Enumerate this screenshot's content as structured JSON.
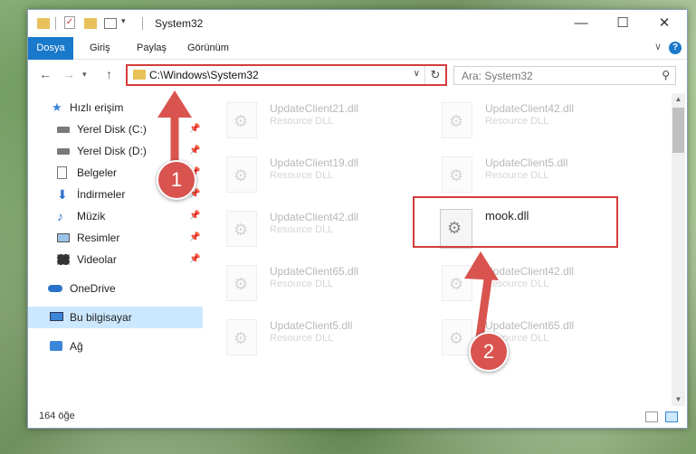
{
  "window": {
    "title": "System32"
  },
  "ribbon": {
    "tabs": [
      "Dosya",
      "Giriş",
      "Paylaş",
      "Görünüm"
    ]
  },
  "nav": {
    "address": "C:\\Windows\\System32",
    "search_placeholder": "Ara: System32"
  },
  "sidebar": {
    "items": [
      {
        "label": "Hızlı erişim",
        "icon": "star-icon"
      },
      {
        "label": "Yerel Disk (C:)",
        "icon": "drive-icon",
        "pinned": true
      },
      {
        "label": "Yerel Disk (D:)",
        "icon": "drive-icon",
        "pinned": true
      },
      {
        "label": "Belgeler",
        "icon": "documents-icon",
        "pinned": true
      },
      {
        "label": "İndirmeler",
        "icon": "download-icon",
        "pinned": true
      },
      {
        "label": "Müzik",
        "icon": "music-icon",
        "pinned": true
      },
      {
        "label": "Resimler",
        "icon": "pictures-icon",
        "pinned": true
      },
      {
        "label": "Videolar",
        "icon": "videos-icon",
        "pinned": true
      },
      {
        "label": "OneDrive",
        "icon": "cloud-icon"
      },
      {
        "label": "Bu bilgisayar",
        "icon": "computer-icon",
        "selected": true
      },
      {
        "label": "Ağ",
        "icon": "network-icon"
      }
    ]
  },
  "files": [
    {
      "name": "UpdateClient21.dll",
      "type": "Resource DLL"
    },
    {
      "name": "UpdateClient42.dll",
      "type": "Resource DLL"
    },
    {
      "name": "UpdateClient19.dll",
      "type": "Resource DLL"
    },
    {
      "name": "UpdateClient5.dll",
      "type": "Resource DLL"
    },
    {
      "name": "UpdateClient42.dll",
      "type": "Resource DLL"
    },
    {
      "name": "mook.dll",
      "type": ""
    },
    {
      "name": "UpdateClient65.dll",
      "type": "Resource DLL"
    },
    {
      "name": "UpdateClient42.dll",
      "type": "Resource DLL"
    },
    {
      "name": "UpdateClient5.dll",
      "type": "Resource DLL"
    },
    {
      "name": "UpdateClient65.dll",
      "type": "Resource DLL"
    }
  ],
  "status": {
    "count": "164 öğe"
  },
  "annotations": {
    "step1": "1",
    "step2": "2"
  },
  "colors": {
    "accent": "#1979ca",
    "highlight": "#d53c3c"
  }
}
